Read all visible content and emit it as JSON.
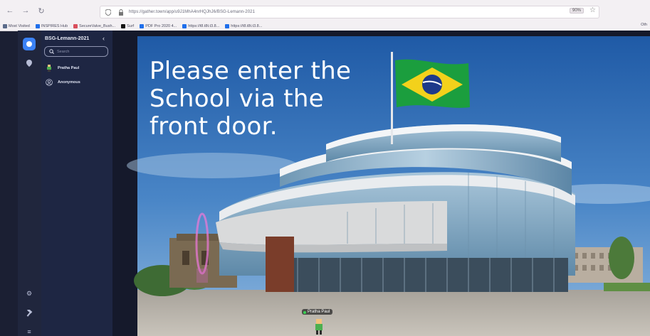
{
  "browser": {
    "url": "https://gather.town/app/u9J1MhA4nrHQJhJ6/BSG-Lemann-2021",
    "zoom": "90%",
    "bookmarks": [
      {
        "label": "Most Visited",
        "color": "#5b6b8a"
      },
      {
        "label": "INSPIRES Hub",
        "color": "#1f6feb"
      },
      {
        "label": "SecureValve_Bush...",
        "color": "#d94f5c"
      },
      {
        "label": "Surf",
        "color": "#111111"
      },
      {
        "label": "PDF Pro 2020 4...",
        "color": "#1f6feb"
      },
      {
        "label": "https://t8.t8t.t3.8...",
        "color": "#1f6feb"
      },
      {
        "label": "https://t8.t8t.t3.8...",
        "color": "#1f6feb"
      }
    ],
    "bookmarks_end": "Oth"
  },
  "sidebar": {
    "space_title": "BSG-Lemann-2021",
    "search_placeholder": "Search",
    "users": [
      {
        "name": "Pratha Paul",
        "avatar": "sprite-avatar-icon"
      },
      {
        "name": "Anonymous",
        "avatar": "user-outline-icon"
      }
    ]
  },
  "rail": {
    "icons": [
      "gather-logo-icon",
      "map-pin-icon",
      "gear-icon",
      "hammer-icon",
      "list-icon"
    ]
  },
  "stage": {
    "caption_lines": [
      "Please enter the",
      "School via the",
      "front door."
    ],
    "player_name": "Pratha Paul",
    "colors": {
      "sky": "#2f6fb6",
      "glass": "#8fb2c9",
      "flag_green": "#1b9e3e",
      "flag_yellow": "#f3d11b",
      "flag_blue": "#1e3a8a"
    }
  }
}
